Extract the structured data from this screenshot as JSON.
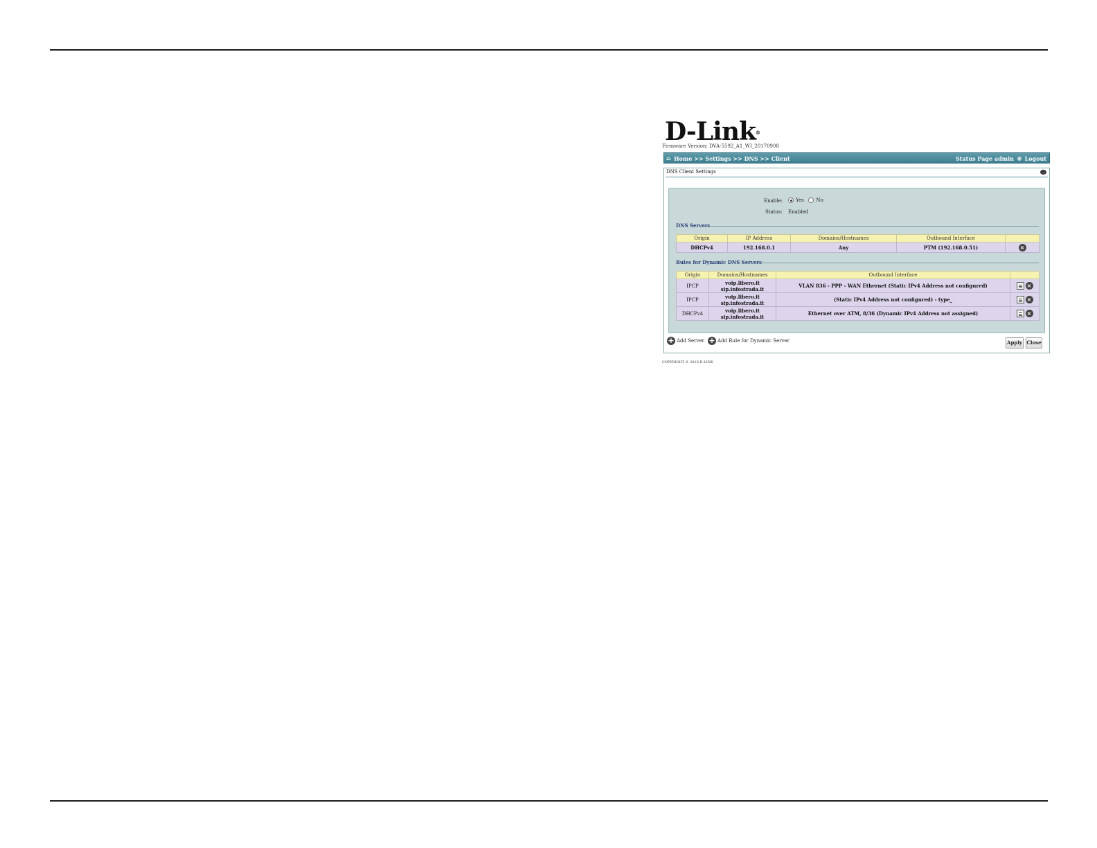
{
  "brand": {
    "logo_text": "D-Link",
    "logo_mark": "®",
    "firmware": "Firmware Version: DVA-5592_A1_WI_20170908"
  },
  "nav": {
    "breadcrumb": "Home >> Settings >> DNS >> Client",
    "status_page_label": "Status Page",
    "user": "admin",
    "logout_label": "Logout"
  },
  "panel": {
    "title": "DNS Client Settings"
  },
  "form": {
    "enable_label": "Enable:",
    "enable_yes": "Yes",
    "enable_no": "No",
    "enable_selected": "Yes",
    "status_label": "Status:",
    "status_value": "Enabled"
  },
  "dns_servers": {
    "title": "DNS Servers",
    "columns": [
      "Origin",
      "IP Address",
      "Domains/Hostnames",
      "Outbound Interface"
    ],
    "rows": [
      {
        "origin": "DHCPv4",
        "ip": "192.168.0.1",
        "domains": "Any",
        "interface": "PTM (192.168.0.51)"
      }
    ]
  },
  "dynamic_rules": {
    "title": "Rules for Dynamic DNS Servers",
    "columns": [
      "Origin",
      "Domains/Hostnames",
      "Outbound Interface"
    ],
    "rows": [
      {
        "origin": "IPCP",
        "domain1": "voip.libero.it",
        "domain2": "sip.infostrada.it",
        "interface": "VLAN 836 - PPP - WAN Ethernet (Static IPv4 Address not configured)"
      },
      {
        "origin": "IPCP",
        "domain1": "voip.libero.it",
        "domain2": "sip.infostrada.it",
        "interface": "(Static IPv4 Address not configured) - type_"
      },
      {
        "origin": "DHCPv4",
        "domain1": "voip.libero.it",
        "domain2": "sip.infostrada.it",
        "interface": "Ethernet over ATM, 8/36 (Dynamic IPv4 Address not assigned)"
      }
    ]
  },
  "actions": {
    "add_server": "Add Server",
    "add_rule": "Add Rule for Dynamic Server",
    "apply": "Apply",
    "close": "Close"
  },
  "footer": {
    "copyright": "COPYRIGHT © 2016 D-LINK"
  },
  "icons": {
    "home": "home-icon",
    "help": "help-icon",
    "delete": "close-circle-icon",
    "edit": "edit-icon",
    "add": "plus-circle-icon"
  },
  "colors": {
    "navbar": "#3c7e90",
    "table_header": "#f6f2b0",
    "table_row": "#ddd5ec",
    "panel_bg": "#c9d8d8",
    "section_title": "#2a3f78"
  }
}
